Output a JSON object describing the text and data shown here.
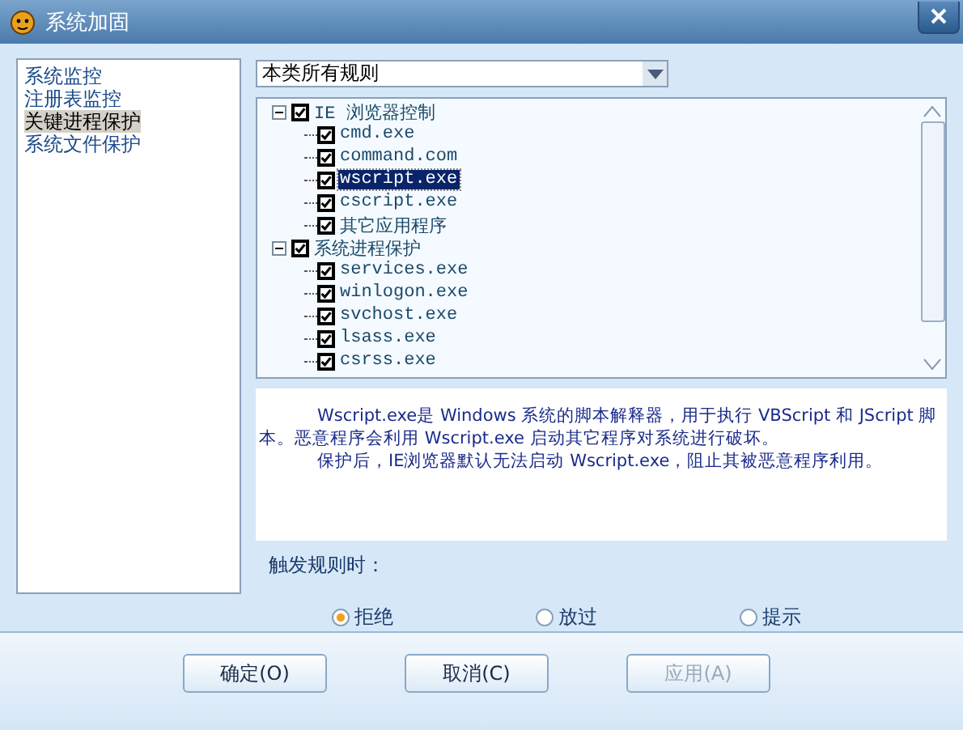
{
  "window": {
    "title": "系统加固"
  },
  "sidebar": {
    "items": [
      {
        "label": "系统监控",
        "selected": false
      },
      {
        "label": "注册表监控",
        "selected": false
      },
      {
        "label": "关键进程保护",
        "selected": true
      },
      {
        "label": "系统文件保护",
        "selected": false
      }
    ]
  },
  "filter": {
    "value": "本类所有规则"
  },
  "tree": [
    {
      "label": "IE 浏览器控制",
      "checked": true,
      "expanded": true,
      "selected": false,
      "children": [
        {
          "label": "cmd.exe",
          "checked": true,
          "selected": false
        },
        {
          "label": "command.com",
          "checked": true,
          "selected": false
        },
        {
          "label": "wscript.exe",
          "checked": true,
          "selected": true
        },
        {
          "label": "cscript.exe",
          "checked": true,
          "selected": false
        },
        {
          "label": "其它应用程序",
          "checked": true,
          "selected": false
        }
      ]
    },
    {
      "label": "系统进程保护",
      "checked": true,
      "expanded": true,
      "selected": false,
      "children": [
        {
          "label": "services.exe",
          "checked": true,
          "selected": false
        },
        {
          "label": "winlogon.exe",
          "checked": true,
          "selected": false
        },
        {
          "label": "svchost.exe",
          "checked": true,
          "selected": false
        },
        {
          "label": "lsass.exe",
          "checked": true,
          "selected": false
        },
        {
          "label": "csrss.exe",
          "checked": true,
          "selected": false
        }
      ]
    }
  ],
  "description": [
    "Wscript.exe是 Windows 系统的脚本解释器，用于执行 VBScript 和 JScript 脚本。恶意程序会利用 Wscript.exe 启动其它程序对系统进行破坏。",
    "保护后，IE浏览器默认无法启动 Wscript.exe，阻止其被恶意程序利用。"
  ],
  "trigger": {
    "label": "触发规则时：",
    "options": [
      {
        "label": "拒绝",
        "selected": true
      },
      {
        "label": "放过",
        "selected": false
      },
      {
        "label": "提示",
        "selected": false
      }
    ]
  },
  "buttons": [
    {
      "label": "确定(O)",
      "disabled": false
    },
    {
      "label": "取消(C)",
      "disabled": false
    },
    {
      "label": "应用(A)",
      "disabled": true
    }
  ]
}
